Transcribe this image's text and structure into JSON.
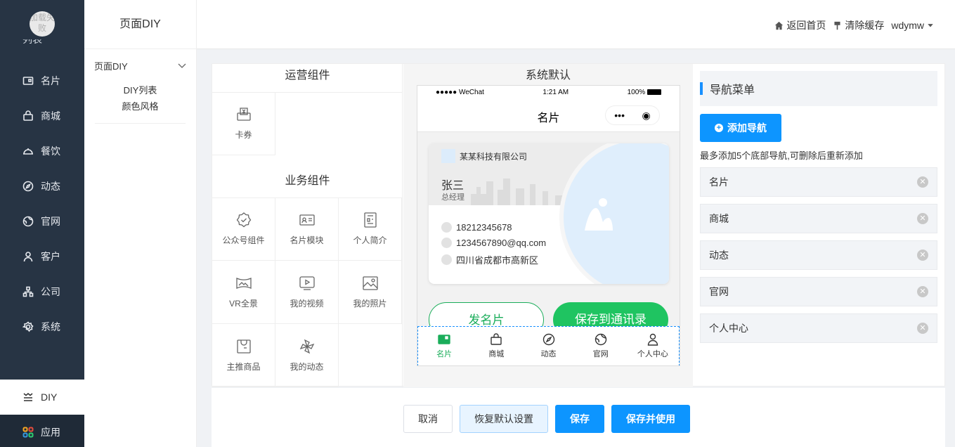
{
  "sidebar": {
    "logo_text": "加载失败",
    "partial_item": "列表",
    "items": [
      {
        "label": "名片",
        "icon": "card-icon"
      },
      {
        "label": "商城",
        "icon": "bag-icon"
      },
      {
        "label": "餐饮",
        "icon": "dish-icon"
      },
      {
        "label": "动态",
        "icon": "compass-icon"
      },
      {
        "label": "官网",
        "icon": "globe-icon"
      },
      {
        "label": "客户",
        "icon": "user-icon"
      },
      {
        "label": "公司",
        "icon": "org-icon"
      },
      {
        "label": "系统",
        "icon": "gear-icon"
      },
      {
        "label": "DIY",
        "icon": "diy-icon"
      },
      {
        "label": "应用",
        "icon": "apps-icon"
      }
    ]
  },
  "subnav": {
    "title": "页面DIY",
    "group": "页面DIY",
    "links": [
      "DIY列表",
      "颜色风格"
    ]
  },
  "header": {
    "home": "返回首页",
    "clear_cache": "清除缓存",
    "user": "wdymw"
  },
  "components": {
    "ops_title": "运营组件",
    "ops": [
      "卡券"
    ],
    "biz_title": "业务组件",
    "biz": [
      "公众号组件",
      "名片模块",
      "个人简介",
      "VR全景",
      "我的视频",
      "我的照片",
      "主推商品",
      "我的动态"
    ]
  },
  "preview": {
    "title": "系统默认",
    "status_left": "●●●●● WeChat",
    "status_time": "1:21 AM",
    "status_right": "100%",
    "nav_title": "名片",
    "capsule_dots": "•••",
    "capsule_target": "◉",
    "company": "某某科技有限公司",
    "name": "张三",
    "job": "总经理",
    "phone": "18212345678",
    "email": "1234567890@qq.com",
    "address": "四川省成都市高新区",
    "btn_send": "发名片",
    "btn_save": "保存到通讯录",
    "tabs": [
      "名片",
      "商城",
      "动态",
      "官网",
      "个人中心"
    ]
  },
  "nav_menu": {
    "title": "导航菜单",
    "add": "添加导航",
    "hint": "最多添加5个底部导航,可删除后重新添加",
    "items": [
      "名片",
      "商城",
      "动态",
      "官网",
      "个人中心"
    ]
  },
  "actions": {
    "cancel": "取消",
    "reset": "恢复默认设置",
    "save": "保存",
    "save_use": "保存并使用"
  },
  "colors": {
    "sidebar_bg": "#273444",
    "primary": "#0d95ff",
    "green": "#1fc461"
  }
}
